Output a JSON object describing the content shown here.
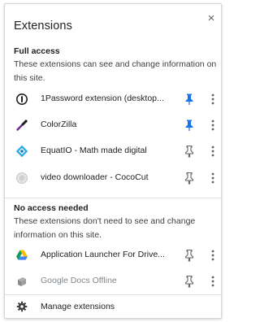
{
  "header": {
    "title": "Extensions",
    "close_glyph": "×"
  },
  "full_access": {
    "title": "Full access",
    "description": "These extensions can see and change information on this site.",
    "items": [
      {
        "label": "1Password extension (desktop...",
        "icon": "1password-icon",
        "pinned": true
      },
      {
        "label": "ColorZilla",
        "icon": "colorzilla-dropper-icon",
        "pinned": true
      },
      {
        "label": "EquatIO - Math made digital",
        "icon": "equatio-icon",
        "pinned": false
      },
      {
        "label": "video downloader - CocoCut",
        "icon": "cococut-icon",
        "pinned": false
      }
    ]
  },
  "no_access": {
    "title": "No access needed",
    "description": "These extensions don't need to see and change information on this site.",
    "items": [
      {
        "label": "Application Launcher For Drive...",
        "icon": "google-drive-icon",
        "pinned": false
      },
      {
        "label": "Google Docs Offline",
        "icon": "google-docs-offline-icon",
        "pinned": false
      }
    ]
  },
  "footer": {
    "manage_label": "Manage extensions",
    "icon": "gear-icon"
  },
  "colors": {
    "pin_active": "#1a73e8",
    "pin_inactive": "#5f6368",
    "menu": "#5f6368"
  }
}
